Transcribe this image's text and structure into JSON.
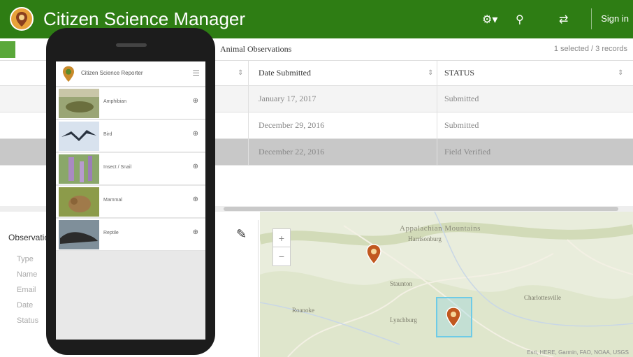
{
  "header": {
    "title": "Citizen Science Manager",
    "sign_in": "Sign in",
    "bg_color": "#2e7d14",
    "icons": [
      "settings-icon",
      "search-icon",
      "refresh-icon"
    ]
  },
  "subbar": {
    "layer_title": "Animal Observations",
    "selection_count": "1 selected / 3 records"
  },
  "table": {
    "columns": [
      "Date Submitted",
      "STATUS"
    ],
    "rows": [
      {
        "date": "January 17, 2017",
        "status": "Submitted"
      },
      {
        "date": "December 29, 2016",
        "status": "Submitted"
      },
      {
        "date": "December 22, 2016",
        "status": "Field Verified"
      }
    ]
  },
  "detail": {
    "heading": "Observation",
    "fields": [
      "Type",
      "Name",
      "Email",
      "Date",
      "Status"
    ]
  },
  "map": {
    "labels": {
      "region": "Appalachian Mountains",
      "town1": "Harrisonburg",
      "town2": "Staunton",
      "town3": "Lynchburg",
      "town4": "Charlottesville",
      "town5": "Roanoke"
    },
    "attribution": "Esri, HERE, Garmin, FAO, NOAA, USGS"
  },
  "phone": {
    "app_title": "Citizen Science Reporter",
    "items": [
      {
        "label": "Amphibian"
      },
      {
        "label": "Bird"
      },
      {
        "label": "Insect / Snail"
      },
      {
        "label": "Mammal"
      },
      {
        "label": "Reptile"
      }
    ]
  }
}
